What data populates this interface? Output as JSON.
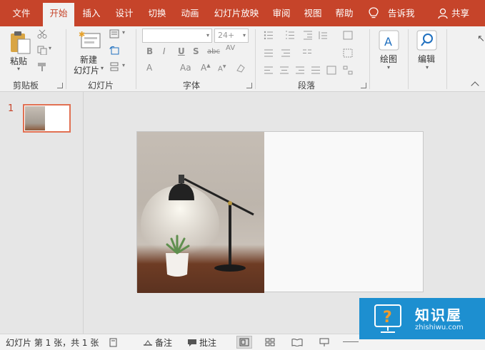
{
  "tabs": [
    "文件",
    "开始",
    "插入",
    "设计",
    "切换",
    "动画",
    "幻灯片放映",
    "审阅",
    "视图",
    "帮助"
  ],
  "active_tab": "开始",
  "tell_me": "告诉我",
  "share": "共享",
  "ribbon": {
    "clipboard": {
      "paste_label": "粘贴",
      "group_label": "剪贴板"
    },
    "slides": {
      "new_slide_label_1": "新建",
      "new_slide_label_2": "幻灯片",
      "group_label": "幻灯片"
    },
    "font": {
      "size_value": "24+",
      "group_label": "字体"
    },
    "paragraph": {
      "group_label": "段落"
    },
    "drawing": {
      "label": "绘图"
    },
    "editing": {
      "label": "编辑"
    }
  },
  "thumbnails": {
    "slide_number": "1"
  },
  "status": {
    "slide_info": "幻灯片 第 1 张，共 1 张",
    "notes": "备注",
    "comments": "批注"
  },
  "watermark": {
    "title": "知识屋",
    "url": "zhishiwu.com"
  },
  "colors": {
    "accent": "#c6442a",
    "ribbon_bg": "#f1f1f1",
    "canvas_bg": "#e6e6e6"
  }
}
